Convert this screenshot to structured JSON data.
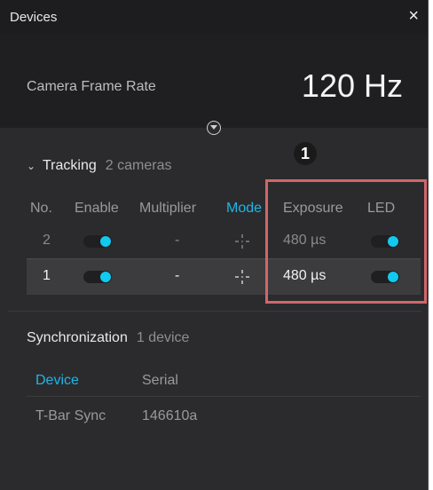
{
  "window": {
    "title": "Devices",
    "close_glyph": "×"
  },
  "frame_rate": {
    "label": "Camera Frame Rate",
    "value": "120 Hz"
  },
  "tracking": {
    "title": "Tracking",
    "count": "2 cameras",
    "columns": [
      "No.",
      "Enable",
      "Multiplier",
      "Mode",
      "Exposure",
      "LED"
    ],
    "active_column": "Mode",
    "rows": [
      {
        "no": "2",
        "enable": true,
        "multiplier": "-",
        "exposure": "480 µs",
        "led": true,
        "selected": false
      },
      {
        "no": "1",
        "enable": true,
        "multiplier": "-",
        "exposure": "480 µs",
        "led": true,
        "selected": true
      }
    ]
  },
  "callout": {
    "number": "1"
  },
  "synchronization": {
    "title": "Synchronization",
    "count": "1 device",
    "columns": [
      "Device",
      "Serial"
    ],
    "rows": [
      {
        "device": "T-Bar Sync",
        "serial": "146610a"
      }
    ]
  },
  "colors": {
    "accent": "#1fb5e7",
    "toggle_on": "#12c9ef",
    "callout": "#d0676a"
  },
  "icons": {
    "collapse": "chevron-down-circle-icon",
    "tracking_expand": "chevron-down-icon",
    "mode": "crosshair-mode-icon",
    "close": "close-icon"
  }
}
